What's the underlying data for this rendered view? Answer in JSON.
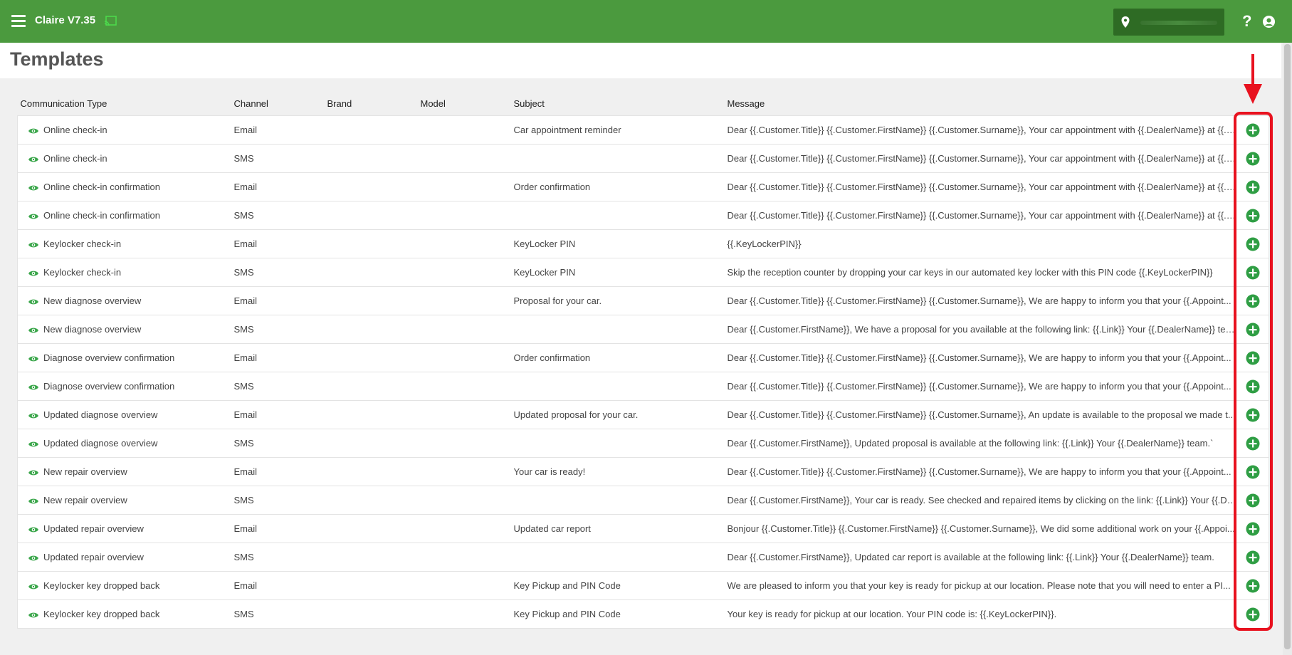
{
  "app": {
    "title": "Claire V7.35"
  },
  "page": {
    "title": "Templates"
  },
  "colors": {
    "header_green": "#4b9a3e",
    "accent_green": "#3aa64a",
    "highlight_red": "#e8121f"
  },
  "icons": {
    "menu": "menu-icon",
    "cast": "cast-icon",
    "location": "location-pin-icon",
    "help": "question-mark-icon",
    "user": "user-circle-icon",
    "row_view": "eye-icon",
    "row_add": "plus-circle-icon"
  },
  "help_glyph": "?",
  "table": {
    "columns": [
      "Communication Type",
      "Channel",
      "Brand",
      "Model",
      "Subject",
      "Message"
    ],
    "rows": [
      {
        "type": "Online check-in",
        "channel": "Email",
        "brand": "",
        "model": "",
        "subject": "Car appointment reminder",
        "message": "Dear {{.Customer.Title}} {{.Customer.FirstName}} {{.Customer.Surname}}, Your car appointment with {{.DealerName}} at {{.L..."
      },
      {
        "type": "Online check-in",
        "channel": "SMS",
        "brand": "",
        "model": "",
        "subject": "",
        "message": "Dear {{.Customer.Title}} {{.Customer.FirstName}} {{.Customer.Surname}}, Your car appointment with {{.DealerName}} at {{.L..."
      },
      {
        "type": "Online check-in confirmation",
        "channel": "Email",
        "brand": "",
        "model": "",
        "subject": "Order confirmation",
        "message": "Dear {{.Customer.Title}} {{.Customer.FirstName}} {{.Customer.Surname}}, Your car appointment with {{.DealerName}} at {{.L..."
      },
      {
        "type": "Online check-in confirmation",
        "channel": "SMS",
        "brand": "",
        "model": "",
        "subject": "",
        "message": "Dear {{.Customer.Title}} {{.Customer.FirstName}} {{.Customer.Surname}}, Your car appointment with {{.DealerName}} at {{.L..."
      },
      {
        "type": "Keylocker check-in",
        "channel": "Email",
        "brand": "",
        "model": "",
        "subject": "KeyLocker PIN",
        "message": "{{.KeyLockerPIN}}"
      },
      {
        "type": "Keylocker check-in",
        "channel": "SMS",
        "brand": "",
        "model": "",
        "subject": "KeyLocker PIN",
        "message": "Skip the reception counter by dropping your car keys in our automated key locker with this PIN code {{.KeyLockerPIN}}"
      },
      {
        "type": "New diagnose overview",
        "channel": "Email",
        "brand": "",
        "model": "",
        "subject": "Proposal for your car.",
        "message": "Dear {{.Customer.Title}} {{.Customer.FirstName}} {{.Customer.Surname}}, We are happy to inform you that your {{.Appoint..."
      },
      {
        "type": "New diagnose overview",
        "channel": "SMS",
        "brand": "",
        "model": "",
        "subject": "",
        "message": "Dear {{.Customer.FirstName}}, We have a proposal for you available at the following link: {{.Link}} Your {{.DealerName}} tea..."
      },
      {
        "type": "Diagnose overview confirmation",
        "channel": "Email",
        "brand": "",
        "model": "",
        "subject": "Order confirmation",
        "message": "Dear {{.Customer.Title}} {{.Customer.FirstName}} {{.Customer.Surname}}, We are happy to inform you that your {{.Appoint..."
      },
      {
        "type": "Diagnose overview confirmation",
        "channel": "SMS",
        "brand": "",
        "model": "",
        "subject": "",
        "message": "Dear {{.Customer.Title}} {{.Customer.FirstName}} {{.Customer.Surname}}, We are happy to inform you that your {{.Appoint..."
      },
      {
        "type": "Updated diagnose overview",
        "channel": "Email",
        "brand": "",
        "model": "",
        "subject": "Updated proposal for your car.",
        "message": "Dear {{.Customer.Title}} {{.Customer.FirstName}} {{.Customer.Surname}}, An update is available to the proposal we made t..."
      },
      {
        "type": "Updated diagnose overview",
        "channel": "SMS",
        "brand": "",
        "model": "",
        "subject": "",
        "message": "Dear {{.Customer.FirstName}}, Updated proposal is available at the following link: {{.Link}} Your {{.DealerName}} team.`"
      },
      {
        "type": "New repair overview",
        "channel": "Email",
        "brand": "",
        "model": "",
        "subject": "Your car is ready!",
        "message": "Dear {{.Customer.Title}} {{.Customer.FirstName}} {{.Customer.Surname}}, We are happy to inform you that your {{.Appoint..."
      },
      {
        "type": "New repair overview",
        "channel": "SMS",
        "brand": "",
        "model": "",
        "subject": "",
        "message": "Dear {{.Customer.FirstName}}, Your car is ready. See checked and repaired items by clicking on the link: {{.Link}} Your {{.De..."
      },
      {
        "type": "Updated repair overview",
        "channel": "Email",
        "brand": "",
        "model": "",
        "subject": "Updated car report",
        "message": "Bonjour {{.Customer.Title}} {{.Customer.FirstName}} {{.Customer.Surname}}, We did some additional work on your {{.Appoi..."
      },
      {
        "type": "Updated repair overview",
        "channel": "SMS",
        "brand": "",
        "model": "",
        "subject": "",
        "message": "Dear {{.Customer.FirstName}}, Updated car report is available at the following link: {{.Link}} Your {{.DealerName}} team."
      },
      {
        "type": "Keylocker key dropped back",
        "channel": "Email",
        "brand": "",
        "model": "",
        "subject": "Key Pickup and PIN Code",
        "message": "We are pleased to inform you that your key is ready for pickup at our location. Please note that you will need to enter a PI..."
      },
      {
        "type": "Keylocker key dropped back",
        "channel": "SMS",
        "brand": "",
        "model": "",
        "subject": "Key Pickup and PIN Code",
        "message": "Your key is ready for pickup at our location. Your PIN code is: {{.KeyLockerPIN}}."
      }
    ]
  }
}
